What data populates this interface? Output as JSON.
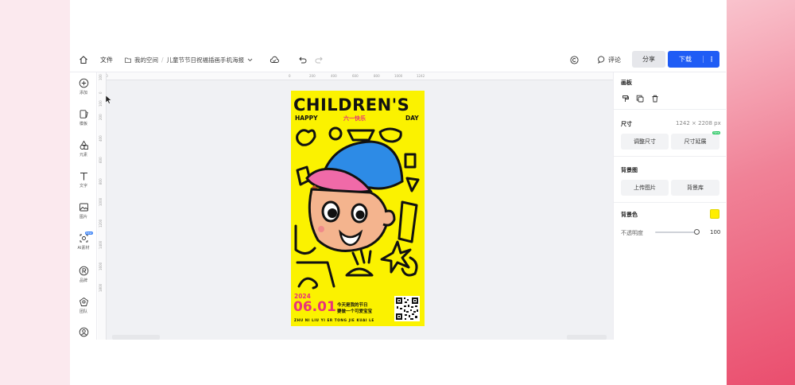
{
  "topbar": {
    "file_menu": "文件",
    "breadcrumb": {
      "space": "我的空间",
      "separator": "/",
      "document": "儿童节节日祝福插画手机海报"
    },
    "comment_label": "评论",
    "share_label": "分享",
    "download_label": "下载",
    "more_label": "⋮"
  },
  "sidebar": {
    "items": [
      {
        "label": "添加",
        "icon": "plus-circle-icon"
      },
      {
        "label": "模板",
        "icon": "template-icon"
      },
      {
        "label": "元素",
        "icon": "shapes-icon"
      },
      {
        "label": "文字",
        "icon": "text-icon"
      },
      {
        "label": "图片",
        "icon": "image-icon"
      },
      {
        "label": "AI素材",
        "icon": "ai-material-icon",
        "badge": "New"
      },
      {
        "label": "品牌",
        "icon": "brand-icon"
      },
      {
        "label": "团队",
        "icon": "team-icon"
      },
      {
        "label": "",
        "icon": "user-icon"
      }
    ]
  },
  "ruler": {
    "top_ticks": [
      "100",
      "0",
      "200",
      "400",
      "600",
      "800",
      "1000",
      "1242"
    ],
    "left_ticks": [
      "100",
      "0",
      "100",
      "200",
      "400",
      "600",
      "800",
      "1000",
      "1200",
      "1400",
      "1600",
      "1800"
    ]
  },
  "poster": {
    "title": "CHILDREN'S",
    "happy": "HAPPY",
    "cn_subtitle": "六一快乐",
    "day": "DAY",
    "year": "2024",
    "date": "06.01",
    "line1": "今天是我的节日",
    "line2": "要做一个可爱宝宝",
    "pinyin": "ZHU NI LIU YI ER TONG JIE KUAI LE",
    "bg_color": "#fbf200",
    "accent_pink": "#e8327a",
    "cap_blue": "#2d8be6",
    "cap_pink": "#f06aa8"
  },
  "panel": {
    "artboard_title": "画板",
    "size_title": "尺寸",
    "size_value": "1242 × 2208 px",
    "resize_btn": "调整尺寸",
    "extend_btn": "尺寸延展",
    "extend_badge": "New",
    "bg_image_title": "背景图",
    "upload_btn": "上传图片",
    "library_btn": "背景库",
    "bg_color_title": "背景色",
    "bg_color_value": "#ffee00",
    "opacity_label": "不透明度",
    "opacity_value": "100"
  },
  "colors": {
    "primary": "#1f5cf5",
    "backdrop_pink": "#ee5c7a"
  }
}
